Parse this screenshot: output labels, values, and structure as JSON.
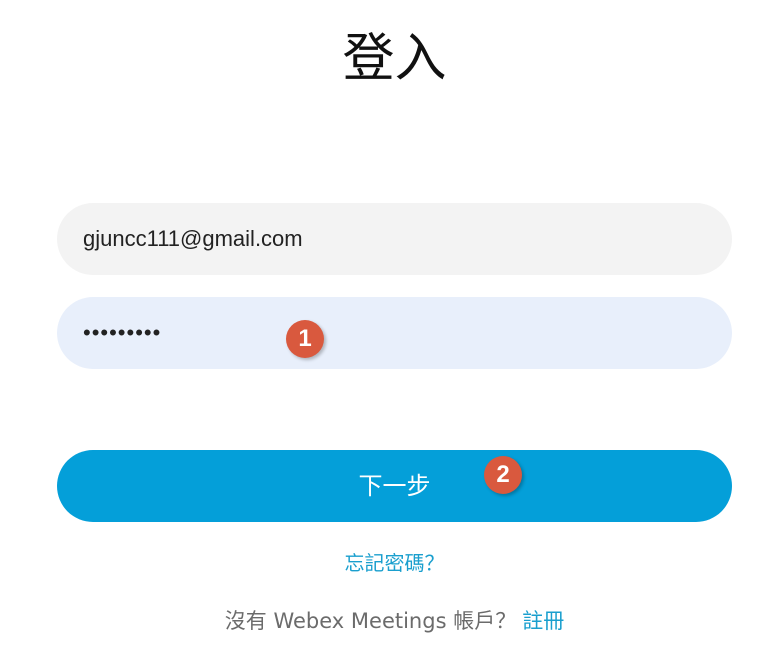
{
  "header": {
    "title": "登入"
  },
  "form": {
    "email_value": "gjuncc111@gmail.com",
    "password_value": "•••••••••",
    "next_label": "下一步"
  },
  "annotations": {
    "marker_1": "1",
    "marker_2": "2"
  },
  "links": {
    "forgot_password": "忘記密碼？",
    "no_account_text": "沒有 Webex Meetings 帳戶？",
    "signup": "註冊"
  },
  "colors": {
    "primary_button": "#049fd9",
    "link": "#1a9fce",
    "email_field_bg": "#f3f3f3",
    "password_field_bg": "#e8effb",
    "marker": "#d9593e"
  }
}
